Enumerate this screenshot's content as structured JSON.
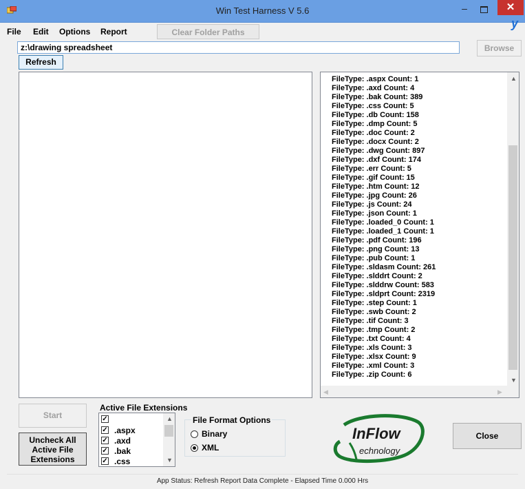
{
  "window": {
    "title": "Win Test Harness V 5.6",
    "minimize": "–",
    "close": "✕",
    "edge_text": "y"
  },
  "menu": {
    "file": "File",
    "edit": "Edit",
    "options": "Options",
    "report": "Report",
    "clear_folder_paths": "Clear Folder Paths"
  },
  "path": {
    "value": "z:\\drawing spreadsheet",
    "browse": "Browse",
    "refresh": "Refresh"
  },
  "report_lines": [
    "FileType: .aspx Count: 1",
    "FileType: .axd Count: 4",
    "FileType: .bak Count: 389",
    "FileType: .css Count: 5",
    "FileType: .db Count: 158",
    "FileType: .dmp Count: 5",
    "FileType: .doc Count: 2",
    "FileType: .docx Count: 2",
    "FileType: .dwg Count: 897",
    "FileType: .dxf Count: 174",
    "FileType: .err Count: 5",
    "FileType: .gif Count: 15",
    "FileType: .htm Count: 12",
    "FileType: .jpg Count: 26",
    "FileType: .js Count: 24",
    "FileType: .json Count: 1",
    "FileType: .loaded_0 Count: 1",
    "FileType: .loaded_1 Count: 1",
    "FileType: .pdf Count: 196",
    "FileType: .png Count: 13",
    "FileType: .pub Count: 1",
    "FileType: .sldasm Count: 261",
    "FileType: .slddrt Count: 2",
    "FileType: .slddrw Count: 583",
    "FileType: .sldprt Count: 2319",
    "FileType: .step Count: 1",
    "FileType: .swb Count: 2",
    "FileType: .tif Count: 3",
    "FileType: .tmp Count: 2",
    "FileType: .txt Count: 4",
    "FileType: .xls Count: 3",
    "FileType: .xlsx Count: 9",
    "FileType: .xml Count: 3",
    "FileType: .zip Count: 6"
  ],
  "controls": {
    "start": "Start",
    "uncheck_all": "Uncheck All Active File Extensions",
    "close": "Close"
  },
  "extensions": {
    "label": "Active File Extensions",
    "items": [
      {
        "label": "",
        "checked": true
      },
      {
        "label": ".aspx",
        "checked": true
      },
      {
        "label": ".axd",
        "checked": true
      },
      {
        "label": ".bak",
        "checked": true
      },
      {
        "label": ".css",
        "checked": true
      }
    ]
  },
  "format": {
    "legend": "File Format Options",
    "binary": "Binary",
    "xml": "XML",
    "selected": "XML"
  },
  "logo": {
    "line1": "InFlow",
    "line2": "echnology",
    "accent": "#1a7a2e"
  },
  "status": {
    "text": "App Status: Refresh Report Data Complete - Elapsed Time 0.000 Hrs"
  }
}
